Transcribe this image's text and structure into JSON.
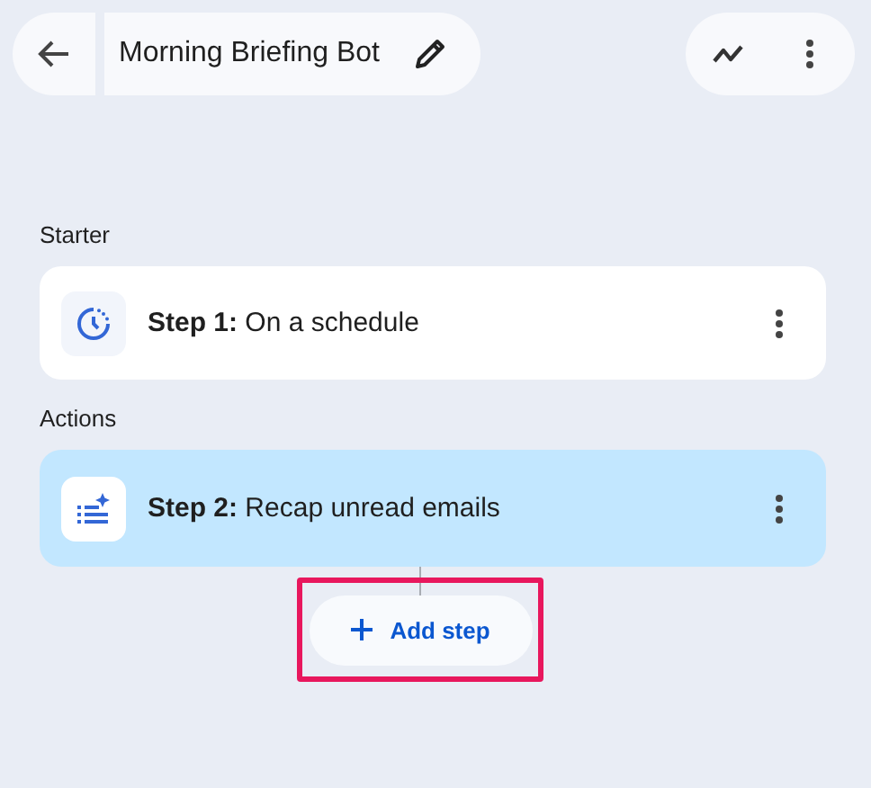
{
  "header": {
    "title": "Morning Briefing Bot"
  },
  "sections": [
    {
      "label": "Starter",
      "steps": [
        {
          "text": "**Step 1:** On a schedule",
          "kind": "schedule",
          "selected": false
        }
      ]
    },
    {
      "label": "Actions",
      "steps": [
        {
          "text": "**Step 2:** Recap unread emails",
          "kind": "ai",
          "selected": true
        }
      ]
    }
  ],
  "add_step": {
    "label": "Add step",
    "highlighted": true
  }
}
